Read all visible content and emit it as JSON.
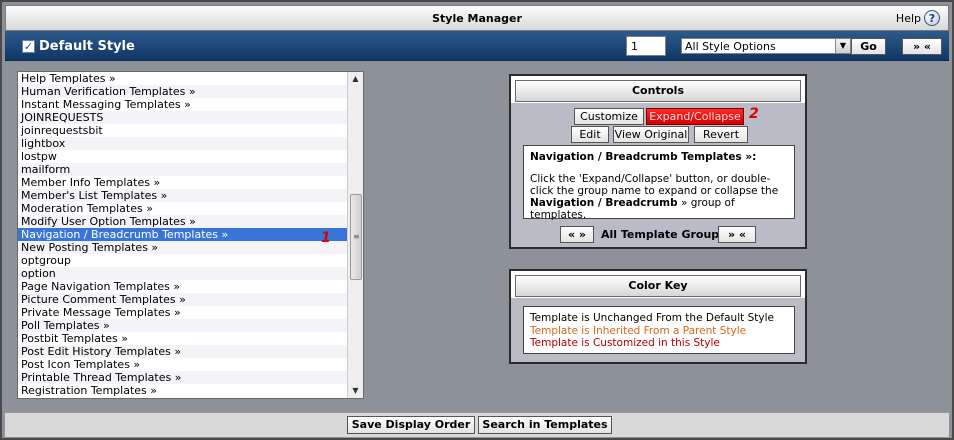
{
  "title": "Style Manager",
  "help_label": "Help",
  "help_icon": "?",
  "style_name": "Default Style",
  "page_number": "1",
  "style_options": {
    "selected": "All Style Options"
  },
  "go_label": "Go",
  "expand_all_label": "» «",
  "list_items": [
    "Help Templates »",
    "Human Verification Templates »",
    "Instant Messaging Templates »",
    "JOINREQUESTS",
    "joinrequestsbit",
    "lightbox",
    "lostpw",
    "mailform",
    "Member Info Templates »",
    "Member's List Templates »",
    "Moderation Templates »",
    "Modify User Option Templates »",
    "Navigation / Breadcrumb Templates »",
    "New Posting Templates »",
    "optgroup",
    "option",
    "Page Navigation Templates »",
    "Picture Comment Templates »",
    "Private Message Templates »",
    "Poll Templates »",
    "Postbit Templates »",
    "Post Edit History Templates »",
    "Post Icon Templates »",
    "Printable Thread Templates »",
    "Registration Templates »"
  ],
  "selected_index": 12,
  "annotations": {
    "one": "1",
    "two": "2"
  },
  "controls": {
    "title": "Controls",
    "customize": "Customize",
    "expand_collapse": "Expand/Collapse",
    "edit": "Edit",
    "view_original": "View Original",
    "revert": "Revert",
    "desc_heading": "Navigation / Breadcrumb Templates »:",
    "desc_pre": "Click the 'Expand/Collapse' button, or double-click the group name to expand or collapse the ",
    "desc_group": "Navigation / Breadcrumb",
    "desc_post": " » group of templates.",
    "collapse_all": "« »",
    "all_groups": "All Template Groups",
    "expand_all": "» «"
  },
  "color_key": {
    "title": "Color Key",
    "unchanged": "Template is Unchanged From the Default Style",
    "inherited": "Template is Inherited From a Parent Style",
    "customized": "Template is Customized in this Style",
    "colors": {
      "unchanged": "#000000",
      "inherited": "#d2691e",
      "customized": "#b00000"
    }
  },
  "footer": {
    "save_display_order": "Save Display Order",
    "search_templates": "Search in Templates"
  }
}
